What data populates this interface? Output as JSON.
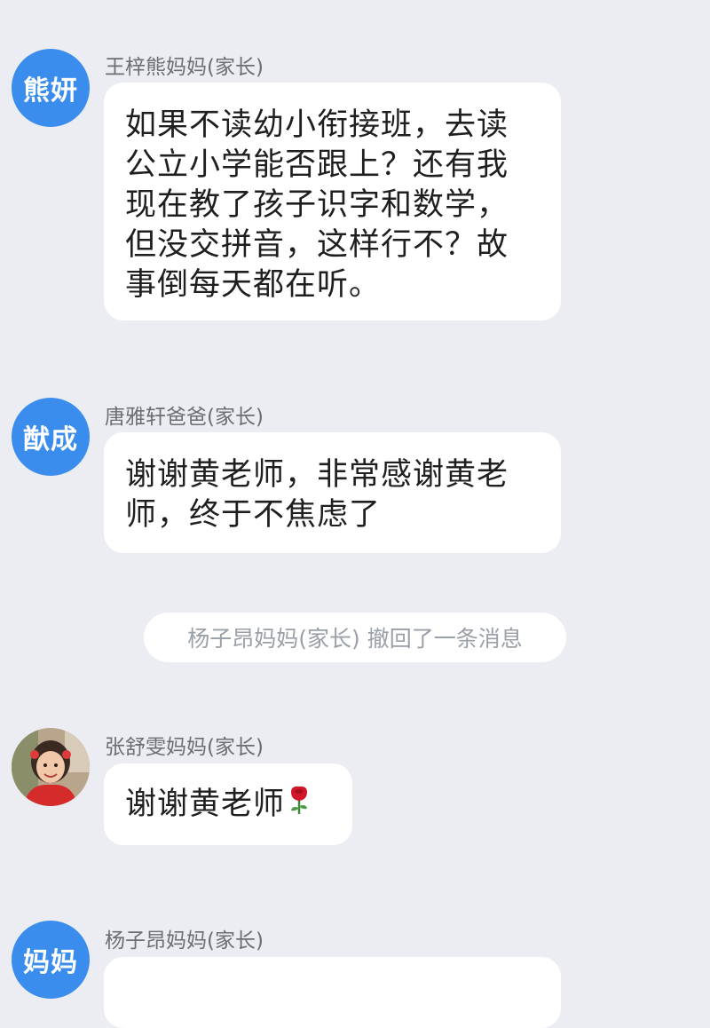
{
  "messages": [
    {
      "avatar_text": "熊妍",
      "sender": "王梓熊妈妈(家长)",
      "lines": [
        "如果不读幼小衔接班，去读",
        "公立小学能否跟上？还有我",
        "现在教了孩子识字和数学，",
        "但没交拼音，这样行不？故",
        "事倒每天都在听。"
      ]
    },
    {
      "avatar_text": "猷成",
      "sender": "唐雅轩爸爸(家长)",
      "lines": [
        "谢谢黄老师，非常感谢黄老",
        "师，终于不焦虑了"
      ]
    },
    {
      "avatar_icon": "child-photo-avatar",
      "sender": "张舒雯妈妈(家长)",
      "text": "谢谢黄老师",
      "emoji_icon": "rose-icon"
    },
    {
      "avatar_text": "妈妈",
      "sender": "杨子昂妈妈(家长)"
    }
  ],
  "system_notice": "杨子昂妈妈(家长) 撤回了一条消息",
  "colors": {
    "background": "#ebedf2",
    "avatar_blue": "#3b8ded",
    "bubble": "#ffffff",
    "sender_text": "#6b6e73",
    "notice_text": "#9aa0a8"
  }
}
